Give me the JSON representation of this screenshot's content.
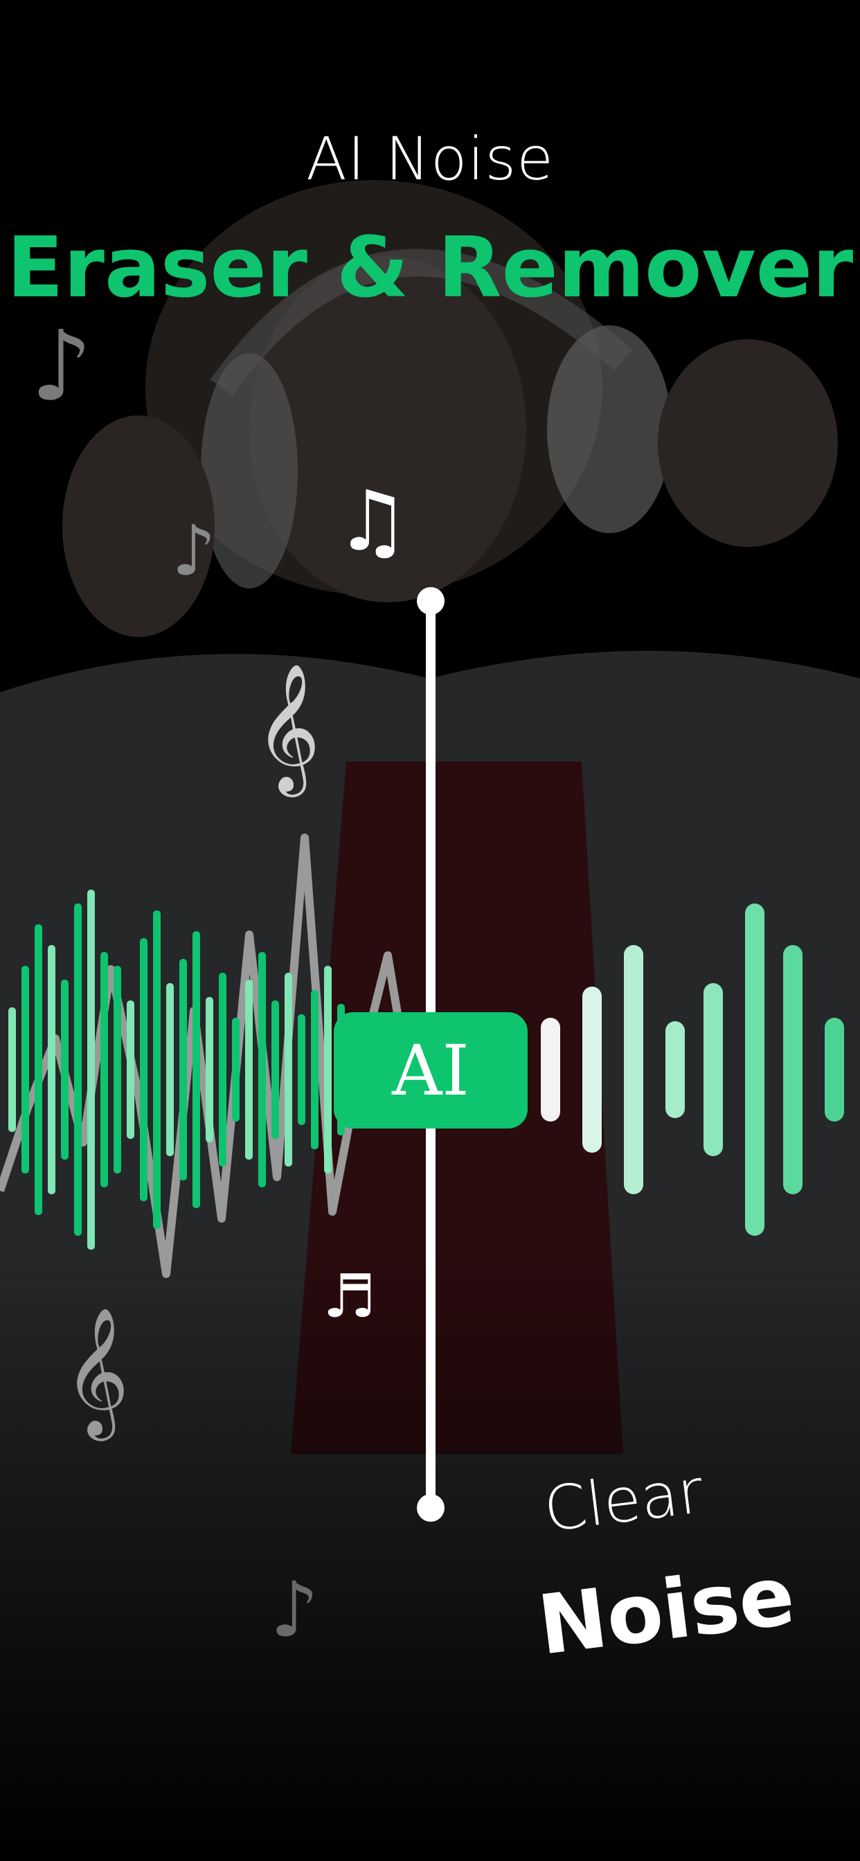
{
  "headline": {
    "line1": "AI Noise",
    "line2": "Eraser & Remover"
  },
  "badge": {
    "label": "AI"
  },
  "caption": {
    "clear": "Clear",
    "noise": "Noise"
  },
  "icons": {
    "note_top": "♫",
    "note_mid": "♬",
    "eighth_note": "♪",
    "treble_clef": "𝄞"
  },
  "colors": {
    "accent": "#0ec46f",
    "accent_light": "#7fe6b4",
    "background": "#000000",
    "text": "#ffffff",
    "noise_line": "#9a9a9a"
  }
}
